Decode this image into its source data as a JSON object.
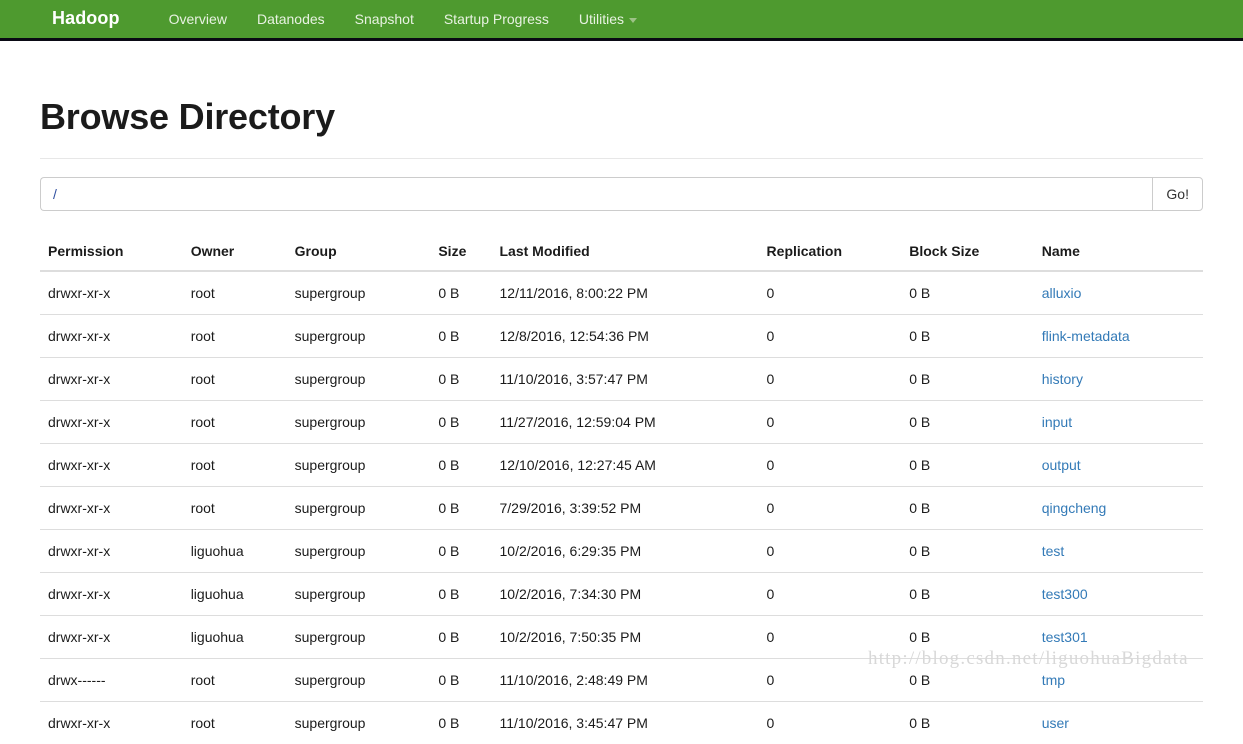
{
  "navbar": {
    "brand": "Hadoop",
    "items": [
      {
        "label": "Overview",
        "name": "nav-overview",
        "caret": false
      },
      {
        "label": "Datanodes",
        "name": "nav-datanodes",
        "caret": false
      },
      {
        "label": "Snapshot",
        "name": "nav-snapshot",
        "caret": false
      },
      {
        "label": "Startup Progress",
        "name": "nav-startup-progress",
        "caret": false
      },
      {
        "label": "Utilities",
        "name": "nav-utilities",
        "caret": true
      }
    ],
    "background_color": "#4e9a2f",
    "border_color": "#0a0a14"
  },
  "page": {
    "title": "Browse Directory"
  },
  "path_bar": {
    "value": "/",
    "placeholder": "Enter a path",
    "go_label": "Go!"
  },
  "table": {
    "columns": [
      "Permission",
      "Owner",
      "Group",
      "Size",
      "Last Modified",
      "Replication",
      "Block Size",
      "Name"
    ],
    "rows": [
      {
        "permission": "drwxr-xr-x",
        "owner": "root",
        "group": "supergroup",
        "size": "0 B",
        "modified": "12/11/2016, 8:00:22 PM",
        "replication": "0",
        "block_size": "0 B",
        "name": "alluxio"
      },
      {
        "permission": "drwxr-xr-x",
        "owner": "root",
        "group": "supergroup",
        "size": "0 B",
        "modified": "12/8/2016, 12:54:36 PM",
        "replication": "0",
        "block_size": "0 B",
        "name": "flink-metadata"
      },
      {
        "permission": "drwxr-xr-x",
        "owner": "root",
        "group": "supergroup",
        "size": "0 B",
        "modified": "11/10/2016, 3:57:47 PM",
        "replication": "0",
        "block_size": "0 B",
        "name": "history"
      },
      {
        "permission": "drwxr-xr-x",
        "owner": "root",
        "group": "supergroup",
        "size": "0 B",
        "modified": "11/27/2016, 12:59:04 PM",
        "replication": "0",
        "block_size": "0 B",
        "name": "input"
      },
      {
        "permission": "drwxr-xr-x",
        "owner": "root",
        "group": "supergroup",
        "size": "0 B",
        "modified": "12/10/2016, 12:27:45 AM",
        "replication": "0",
        "block_size": "0 B",
        "name": "output"
      },
      {
        "permission": "drwxr-xr-x",
        "owner": "root",
        "group": "supergroup",
        "size": "0 B",
        "modified": "7/29/2016, 3:39:52 PM",
        "replication": "0",
        "block_size": "0 B",
        "name": "qingcheng"
      },
      {
        "permission": "drwxr-xr-x",
        "owner": "liguohua",
        "group": "supergroup",
        "size": "0 B",
        "modified": "10/2/2016, 6:29:35 PM",
        "replication": "0",
        "block_size": "0 B",
        "name": "test"
      },
      {
        "permission": "drwxr-xr-x",
        "owner": "liguohua",
        "group": "supergroup",
        "size": "0 B",
        "modified": "10/2/2016, 7:34:30 PM",
        "replication": "0",
        "block_size": "0 B",
        "name": "test300"
      },
      {
        "permission": "drwxr-xr-x",
        "owner": "liguohua",
        "group": "supergroup",
        "size": "0 B",
        "modified": "10/2/2016, 7:50:35 PM",
        "replication": "0",
        "block_size": "0 B",
        "name": "test301"
      },
      {
        "permission": "drwx------",
        "owner": "root",
        "group": "supergroup",
        "size": "0 B",
        "modified": "11/10/2016, 2:48:49 PM",
        "replication": "0",
        "block_size": "0 B",
        "name": "tmp"
      },
      {
        "permission": "drwxr-xr-x",
        "owner": "root",
        "group": "supergroup",
        "size": "0 B",
        "modified": "11/10/2016, 3:45:47 PM",
        "replication": "0",
        "block_size": "0 B",
        "name": "user"
      }
    ]
  },
  "watermark": {
    "text": "http://blog.csdn.net/liguohuaBigdata"
  }
}
